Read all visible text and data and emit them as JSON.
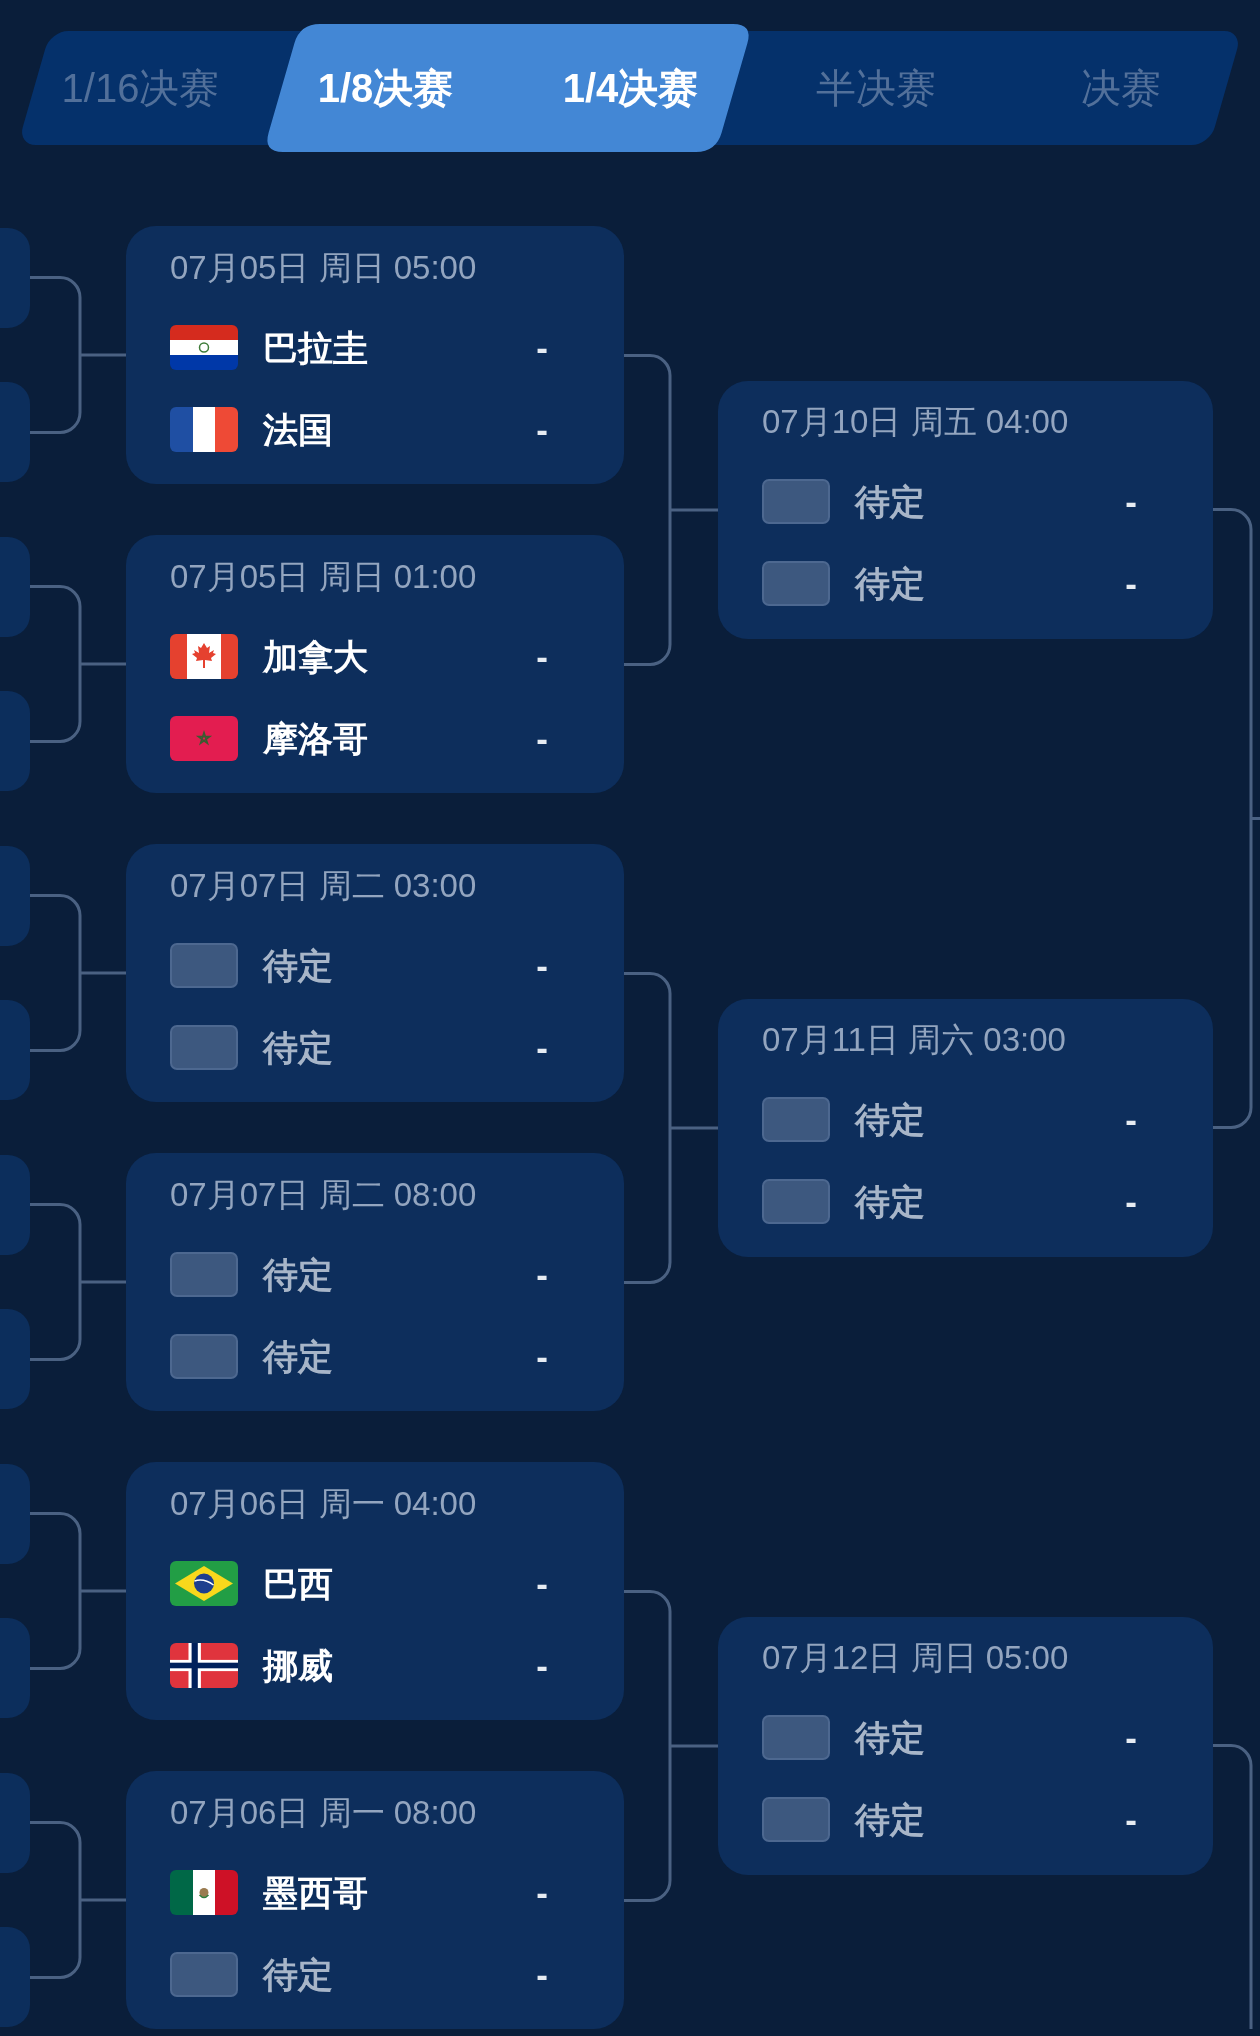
{
  "tabs": [
    {
      "label": "1/16决赛",
      "selected": false
    },
    {
      "label": "1/8决赛",
      "selected": true
    },
    {
      "label": "1/4决赛",
      "selected": true
    },
    {
      "label": "半决赛",
      "selected": false
    },
    {
      "label": "决赛",
      "selected": false
    }
  ],
  "bracket": {
    "round_of_16": [
      {
        "time": "07月05日 周日 05:00",
        "teams": [
          {
            "name": "巴拉圭",
            "kind": "paraguay",
            "score": "-"
          },
          {
            "name": "法国",
            "kind": "france",
            "score": "-"
          }
        ]
      },
      {
        "time": "07月05日 周日 01:00",
        "teams": [
          {
            "name": "加拿大",
            "kind": "canada",
            "score": "-"
          },
          {
            "name": "摩洛哥",
            "kind": "morocco",
            "score": "-"
          }
        ]
      },
      {
        "time": "07月07日 周二 03:00",
        "teams": [
          {
            "name": "待定",
            "kind": "tbd",
            "score": "-"
          },
          {
            "name": "待定",
            "kind": "tbd",
            "score": "-"
          }
        ]
      },
      {
        "time": "07月07日 周二 08:00",
        "teams": [
          {
            "name": "待定",
            "kind": "tbd",
            "score": "-"
          },
          {
            "name": "待定",
            "kind": "tbd",
            "score": "-"
          }
        ]
      },
      {
        "time": "07月06日 周一 04:00",
        "teams": [
          {
            "name": "巴西",
            "kind": "brazil",
            "score": "-"
          },
          {
            "name": "挪威",
            "kind": "norway",
            "score": "-"
          }
        ]
      },
      {
        "time": "07月06日 周一 08:00",
        "teams": [
          {
            "name": "墨西哥",
            "kind": "mexico",
            "score": "-"
          },
          {
            "name": "待定",
            "kind": "tbd",
            "score": "-"
          }
        ]
      }
    ],
    "quarterfinals": [
      {
        "time": "07月10日 周五 04:00",
        "teams": [
          {
            "name": "待定",
            "kind": "tbd",
            "score": "-"
          },
          {
            "name": "待定",
            "kind": "tbd",
            "score": "-"
          }
        ]
      },
      {
        "time": "07月11日 周六 03:00",
        "teams": [
          {
            "name": "待定",
            "kind": "tbd",
            "score": "-"
          },
          {
            "name": "待定",
            "kind": "tbd",
            "score": "-"
          }
        ]
      },
      {
        "time": "07月12日 周日 05:00",
        "teams": [
          {
            "name": "待定",
            "kind": "tbd",
            "score": "-"
          },
          {
            "name": "待定",
            "kind": "tbd",
            "score": "-"
          }
        ]
      }
    ]
  }
}
